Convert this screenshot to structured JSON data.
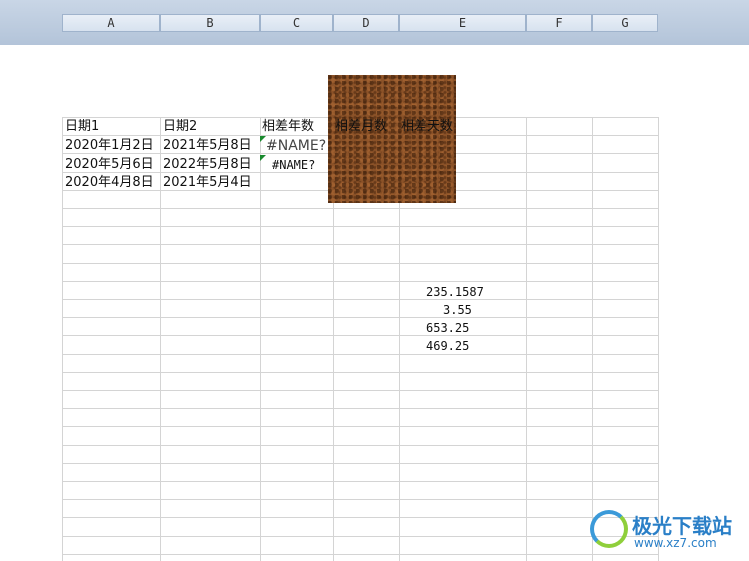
{
  "columns": [
    "A",
    "B",
    "C",
    "D",
    "E",
    "F",
    "G"
  ],
  "headers": {
    "a1": "日期1",
    "b1": "日期2",
    "c1": "相差年数",
    "d1": "相差月数",
    "e1": "相差天数"
  },
  "rows": [
    {
      "a": "2020年1月2日",
      "b": "2021年5月8日",
      "c": "#NAME?"
    },
    {
      "a": "2020年5月6日",
      "b": "2022年5月8日",
      "c": "#NAME?"
    },
    {
      "a": "2020年4月8日",
      "b": "2021年5月4日",
      "c": ""
    }
  ],
  "values": [
    "235.1587",
    "3.55",
    "653.25",
    "469.25"
  ],
  "watermark": {
    "title": "极光下载站",
    "url": "www.xz7.com"
  },
  "colors": {
    "header_bg": "#d7e2ef",
    "grid": "#d4d4d4",
    "error_marker": "#1a8a2e",
    "image": "#8b5228"
  }
}
